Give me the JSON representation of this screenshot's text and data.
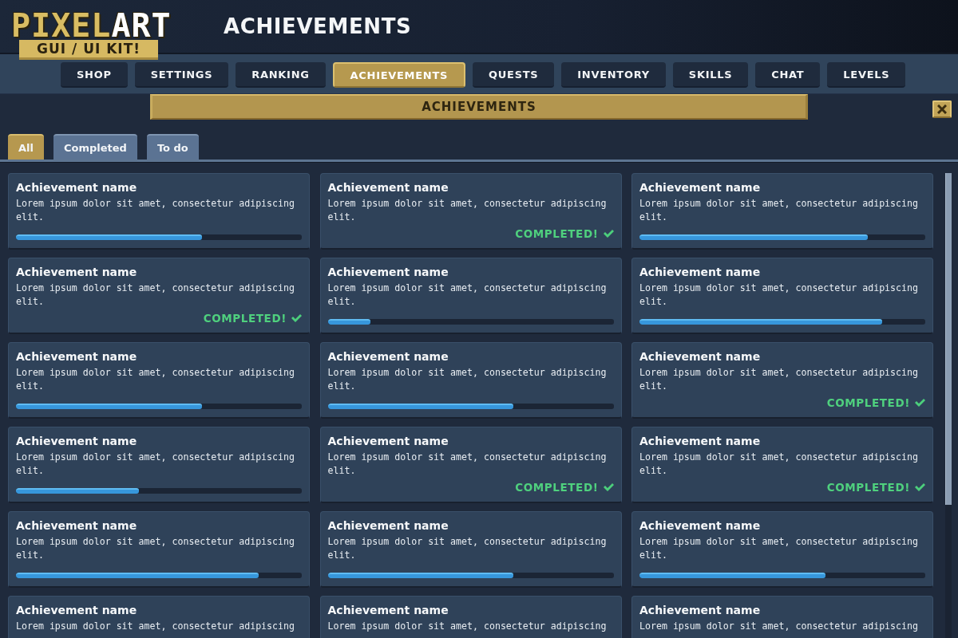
{
  "header": {
    "logo": {
      "title": "PIXEL",
      "title_accent": "ART",
      "subtitle": "GUI / UI KIT!"
    },
    "title": "ACHIEVEMENTS"
  },
  "nav_tabs": [
    {
      "label": "SHOP",
      "selected": false
    },
    {
      "label": "SETTINGS",
      "selected": false
    },
    {
      "label": "RANKING",
      "selected": false
    },
    {
      "label": "ACHIEVEMENTS",
      "selected": true
    },
    {
      "label": "QUESTS",
      "selected": false
    },
    {
      "label": "INVENTORY",
      "selected": false
    },
    {
      "label": "SKILLS",
      "selected": false
    },
    {
      "label": "CHAT",
      "selected": false
    },
    {
      "label": "LEVELS",
      "selected": false
    }
  ],
  "panel": {
    "title": "ACHIEVEMENTS"
  },
  "filter_tabs": [
    {
      "label": "All",
      "selected": true
    },
    {
      "label": "Completed",
      "selected": false
    },
    {
      "label": "To do",
      "selected": false
    }
  ],
  "achievements": [
    {
      "name": "Achievement name",
      "description": "Lorem ipsum dolor sit amet, consectetur adipiscing elit.",
      "kind": "progress",
      "level": 0.65
    },
    {
      "name": "Achievement name",
      "description": "Lorem ipsum dolor sit amet, consectetur adipiscing elit.",
      "kind": "completed",
      "status": "COMPLETED!"
    },
    {
      "name": "Achievement name",
      "description": "Lorem ipsum dolor sit amet, consectetur adipiscing elit.",
      "kind": "progress",
      "level": 0.8
    },
    {
      "name": "Achievement name",
      "description": "Lorem ipsum dolor sit amet, consectetur adipiscing elit.",
      "kind": "completed",
      "status": "COMPLETED!"
    },
    {
      "name": "Achievement name",
      "description": "Lorem ipsum dolor sit amet, consectetur adipiscing elit.",
      "kind": "progress",
      "level": 0.15
    },
    {
      "name": "Achievement name",
      "description": "Lorem ipsum dolor sit amet, consectetur adipiscing elit.",
      "kind": "progress",
      "level": 0.85
    },
    {
      "name": "Achievement name",
      "description": "Lorem ipsum dolor sit amet, consectetur adipiscing elit.",
      "kind": "progress",
      "level": 0.65
    },
    {
      "name": "Achievement name",
      "description": "Lorem ipsum dolor sit amet, consectetur adipiscing elit.",
      "kind": "progress",
      "level": 0.65
    },
    {
      "name": "Achievement name",
      "description": "Lorem ipsum dolor sit amet, consectetur adipiscing elit.",
      "kind": "completed",
      "status": "COMPLETED!"
    },
    {
      "name": "Achievement name",
      "description": "Lorem ipsum dolor sit amet, consectetur adipiscing elit.",
      "kind": "progress",
      "level": 0.43
    },
    {
      "name": "Achievement name",
      "description": "Lorem ipsum dolor sit amet, consectetur adipiscing elit.",
      "kind": "completed",
      "status": "COMPLETED!"
    },
    {
      "name": "Achievement name",
      "description": "Lorem ipsum dolor sit amet, consectetur adipiscing elit.",
      "kind": "completed",
      "status": "COMPLETED!"
    },
    {
      "name": "Achievement name",
      "description": "Lorem ipsum dolor sit amet, consectetur adipiscing elit.",
      "kind": "progress",
      "level": 0.85
    },
    {
      "name": "Achievement name",
      "description": "Lorem ipsum dolor sit amet, consectetur adipiscing elit.",
      "kind": "progress",
      "level": 0.65
    },
    {
      "name": "Achievement name",
      "description": "Lorem ipsum dolor sit amet, consectetur adipiscing elit.",
      "kind": "progress",
      "level": 0.65
    },
    {
      "name": "Achievement name",
      "description": "Lorem ipsum dolor sit amet, consectetur adipiscing"
    },
    {
      "name": "Achievement name",
      "description": "Lorem ipsum dolor sit amet, consectetur adipiscing"
    },
    {
      "name": "Achievement name",
      "description": "Lorem ipsum dolor sit amet, consectetur adipiscing"
    }
  ]
}
